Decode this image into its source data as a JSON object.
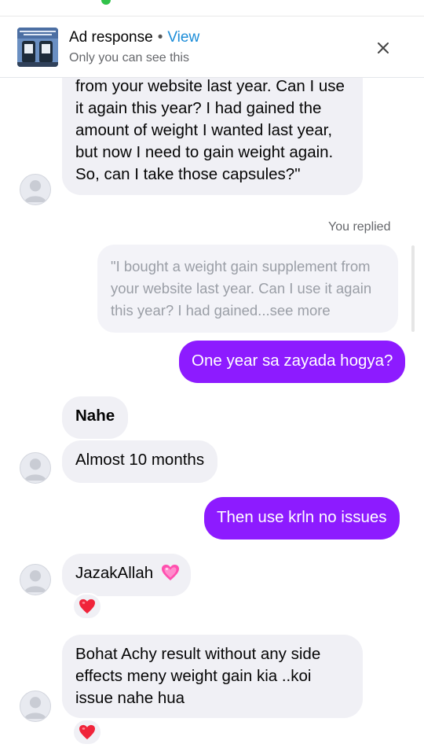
{
  "ad": {
    "title": "Ad response",
    "separator": "•",
    "view_label": "View",
    "subtitle": "Only you can see this"
  },
  "messages": {
    "m1_partial": "from your website last year. Can I use it again this year? I had gained the amount of weight I wanted last year, but now I need to gain weight again. So, can I take those capsules?\"",
    "you_replied": "You replied",
    "quote": "\"I bought a weight gain supplement from your website last year. Can I use it again this year? I had gained...",
    "quote_more": "see more",
    "m2": "One year sa zayada hogya?",
    "m3": "Nahe",
    "m4": "Almost 10 months",
    "m5": "Then use krln no issues",
    "m6": "JazakAllah",
    "m7": "Bohat Achy result without any side effects meny weight gain kia ..koi issue nahe hua"
  },
  "colors": {
    "outgoing_bubble": "#8d1bff",
    "incoming_bubble": "#f0f0f5",
    "link_blue": "#1a8cd8",
    "reaction_heart": "#f0243a"
  },
  "icons": {
    "close": "close-icon",
    "heart_emoji": "pink-heart-emoji",
    "reaction": "red-heart-reaction-icon",
    "avatar": "default-avatar-icon"
  }
}
